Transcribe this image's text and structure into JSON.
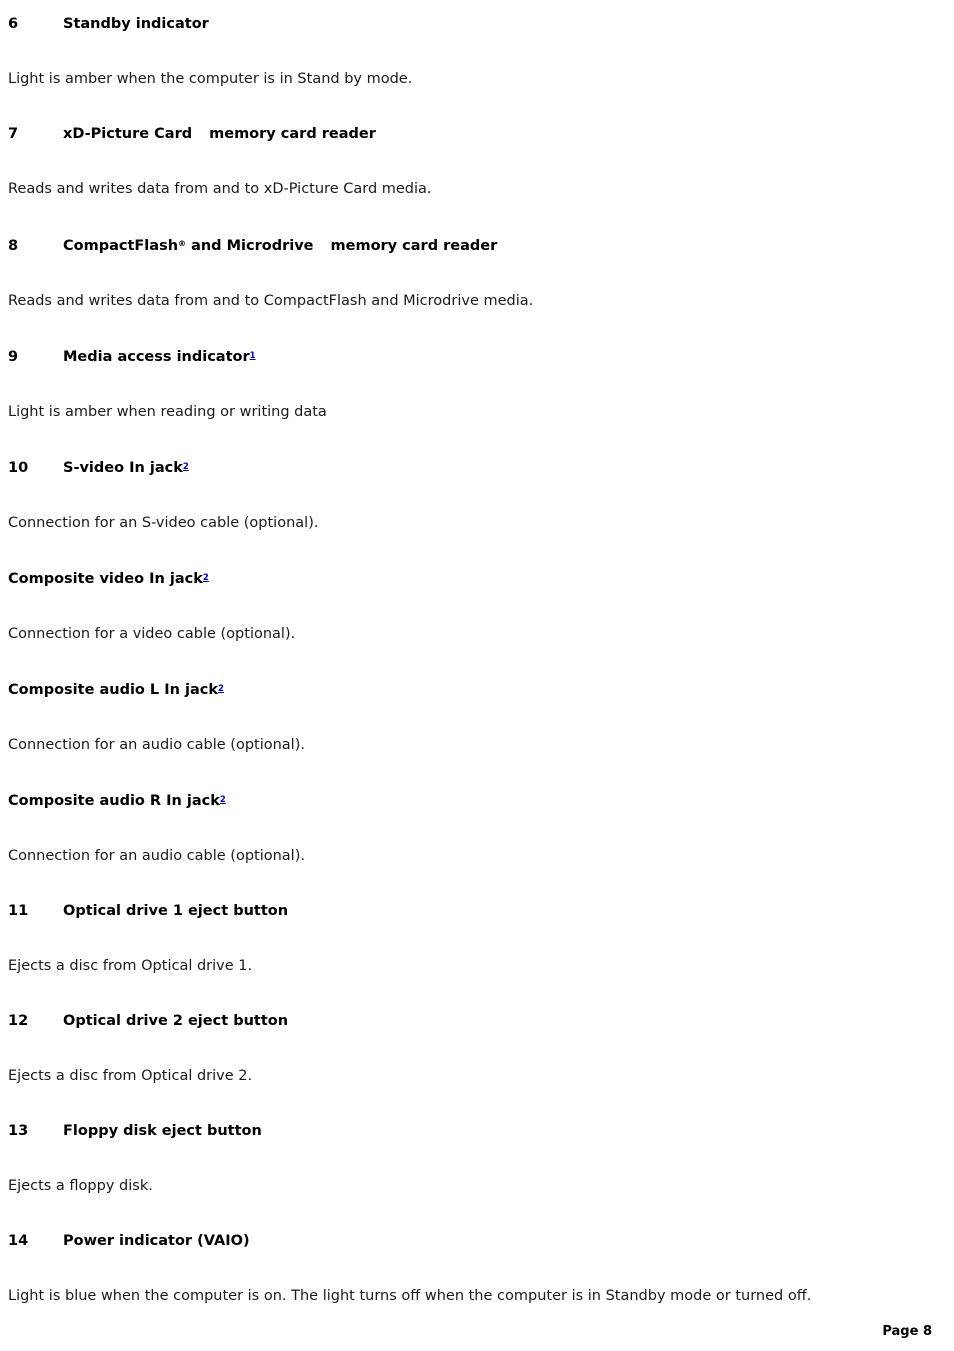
{
  "document": {
    "page_label": "Page 8"
  },
  "entries": [
    {
      "number": "6",
      "heading": "Standby indicator",
      "body": "Light is amber when the computer is in Stand by mode.",
      "has_number": true,
      "registered_mark": "",
      "trademark_suffix": "",
      "footnote": ""
    },
    {
      "number": "7",
      "heading_part1": "xD-Picture Card",
      "heading_part2": "memory card reader",
      "heading": "xD-Picture Card    memory card reader",
      "body": "Reads and writes data from and to xD-Picture Card media.",
      "has_number": true,
      "registered_mark": "",
      "trademark_suffix": "",
      "footnote": ""
    },
    {
      "number": "8",
      "heading_part1": "CompactFlash",
      "heading_part1_mark": "®",
      "heading_part1b": " and Microdrive",
      "heading_part2": "memory card reader",
      "heading": "CompactFlash® and Microdrive    memory card reader",
      "body": "Reads and writes data from and to CompactFlash and Microdrive media.",
      "has_number": true,
      "footnote": ""
    },
    {
      "number": "9",
      "heading": "Media access indicator",
      "body": "Light is amber when reading or writing data",
      "has_number": true,
      "footnote": "1"
    },
    {
      "number": "10",
      "heading": "S-video In jack",
      "body": "Connection for an S-video cable (optional).",
      "has_number": true,
      "footnote": "2"
    },
    {
      "number": "",
      "heading": "Composite video In jack",
      "body": "Connection for a video cable (optional).",
      "has_number": false,
      "footnote": "2"
    },
    {
      "number": "",
      "heading": "Composite audio L In jack",
      "body": "Connection for an audio cable (optional).",
      "has_number": false,
      "footnote": "2"
    },
    {
      "number": "",
      "heading": "Composite audio R In jack",
      "body": "Connection for an audio cable (optional).",
      "has_number": false,
      "footnote": "2"
    },
    {
      "number": "11",
      "heading": "Optical drive 1 eject button",
      "body": "Ejects a disc from Optical drive 1.",
      "has_number": true,
      "footnote": ""
    },
    {
      "number": "12",
      "heading": "Optical drive 2 eject button",
      "body": "Ejects a disc from Optical drive 2.",
      "has_number": true,
      "footnote": ""
    },
    {
      "number": "13",
      "heading": "Floppy disk eject button",
      "body": "Ejects a floppy disk.",
      "has_number": true,
      "footnote": ""
    },
    {
      "number": "14",
      "heading": "Power indicator (VAIO)",
      "body": "Light is blue when the computer is on. The light turns off when the computer is in Standby mode or turned off.",
      "has_number": true,
      "footnote": ""
    }
  ]
}
